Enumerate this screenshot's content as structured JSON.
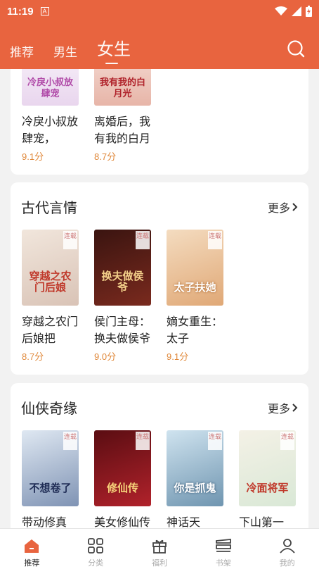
{
  "status": {
    "time": "11:19",
    "a_badge": "A"
  },
  "tabs": [
    {
      "label": "推荐"
    },
    {
      "label": "男生"
    },
    {
      "label": "女生"
    }
  ],
  "accent_color": "#e8643f",
  "top_section": {
    "books": [
      {
        "cover_title": "冷戾小叔放肆宠",
        "title": "冷戾小叔放肆宠，",
        "score": "9.1分"
      },
      {
        "cover_title": "我有我的白月光",
        "title": "离婚后，我有我的白月",
        "score": "8.7分"
      }
    ]
  },
  "sections": [
    {
      "title": "古代言情",
      "more": "更多",
      "books": [
        {
          "cover_title": "穿越之农门后娘",
          "title": "穿越之农门后娘把",
          "score": "8.7分",
          "tag": "连载"
        },
        {
          "cover_title": "换夫做侯爷",
          "title": "侯门主母：换夫做侯爷",
          "score": "9.0分",
          "tag": "连载"
        },
        {
          "cover_title": "太子扶她",
          "title": "嫡女重生：太子",
          "score": "9.1分",
          "tag": "连载"
        }
      ]
    },
    {
      "title": "仙侠奇缘",
      "more": "更多",
      "books": [
        {
          "cover_title": "不想卷了",
          "title": "带动修真",
          "tag": "连载"
        },
        {
          "cover_title": "修仙传",
          "title": "美女修仙传",
          "tag": "连载"
        },
        {
          "cover_title": "你是抓鬼",
          "title": "神话天",
          "tag": "连载"
        },
        {
          "cover_title": "冷面将军",
          "title": "下山第一",
          "tag": "连载"
        }
      ]
    }
  ],
  "bottom_nav": [
    {
      "label": "推荐",
      "icon": "home-icon"
    },
    {
      "label": "分类",
      "icon": "grid-icon"
    },
    {
      "label": "福利",
      "icon": "gift-icon"
    },
    {
      "label": "书架",
      "icon": "bookshelf-icon"
    },
    {
      "label": "我的",
      "icon": "user-icon"
    }
  ]
}
